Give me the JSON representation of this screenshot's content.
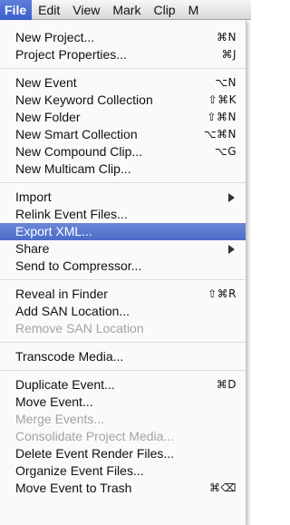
{
  "menubar": {
    "items": [
      "File",
      "Edit",
      "View",
      "Mark",
      "Clip",
      "M"
    ]
  },
  "menu": {
    "new_project": {
      "label": "New Project...",
      "shortcut": "⌘N"
    },
    "project_properties": {
      "label": "Project Properties...",
      "shortcut": "⌘J"
    },
    "new_event": {
      "label": "New Event",
      "shortcut": "⌥N"
    },
    "new_keyword_collection": {
      "label": "New Keyword Collection",
      "shortcut": "⇧⌘K"
    },
    "new_folder": {
      "label": "New Folder",
      "shortcut": "⇧⌘N"
    },
    "new_smart_collection": {
      "label": "New Smart Collection",
      "shortcut": "⌥⌘N"
    },
    "new_compound_clip": {
      "label": "New Compound Clip...",
      "shortcut": "⌥G"
    },
    "new_multicam_clip": {
      "label": "New Multicam Clip..."
    },
    "import": {
      "label": "Import"
    },
    "relink_event_files": {
      "label": "Relink Event Files..."
    },
    "export_xml": {
      "label": "Export XML..."
    },
    "share": {
      "label": "Share"
    },
    "send_to_compressor": {
      "label": "Send to Compressor..."
    },
    "reveal_in_finder": {
      "label": "Reveal in Finder",
      "shortcut": "⇧⌘R"
    },
    "add_san_location": {
      "label": "Add SAN Location..."
    },
    "remove_san_location": {
      "label": "Remove SAN Location"
    },
    "transcode_media": {
      "label": "Transcode Media..."
    },
    "duplicate_event": {
      "label": "Duplicate Event...",
      "shortcut": "⌘D"
    },
    "move_event": {
      "label": "Move Event..."
    },
    "merge_events": {
      "label": "Merge Events..."
    },
    "consolidate_project_media": {
      "label": "Consolidate Project Media..."
    },
    "delete_event_render_files": {
      "label": "Delete Event Render Files..."
    },
    "organize_event_files": {
      "label": "Organize Event Files..."
    },
    "move_event_to_trash": {
      "label": "Move Event to Trash",
      "shortcut": "⌘⌫"
    }
  }
}
